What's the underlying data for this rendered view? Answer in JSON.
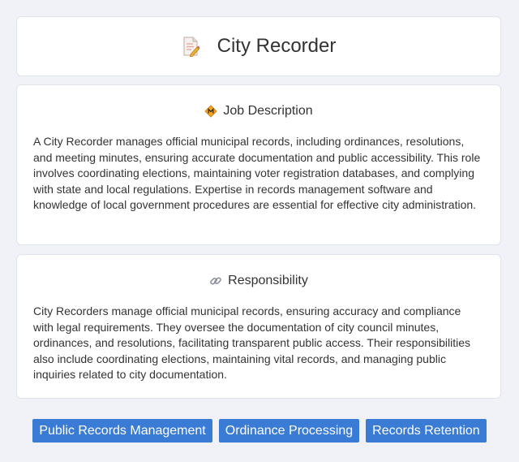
{
  "header": {
    "title": "City Recorder",
    "icon": "document-pencil-icon"
  },
  "job_description": {
    "heading": "Job Description",
    "icon": "diamond-sign-icon",
    "text": "A City Recorder manages official municipal records, including ordinances, resolutions, and meeting minutes, ensuring accurate documentation and public accessibility. This role involves coordinating elections, maintaining voter registration databases, and complying with state and local regulations. Expertise in records management software and knowledge of local government procedures are essential for effective city administration."
  },
  "responsibility": {
    "heading": "Responsibility",
    "icon": "link-icon",
    "text": "City Recorders manage official municipal records, ensuring accuracy and compliance with legal requirements. They oversee the documentation of city council minutes, ordinances, and resolutions, facilitating transparent public access. Their responsibilities also include coordinating elections, maintaining vital records, and managing public inquiries related to city documentation."
  },
  "tags": [
    "Public Records Management",
    "Ordinance Processing",
    "Records Retention"
  ],
  "colors": {
    "tag_background": "#3a7bd5",
    "page_background": "#f0f2f7"
  }
}
